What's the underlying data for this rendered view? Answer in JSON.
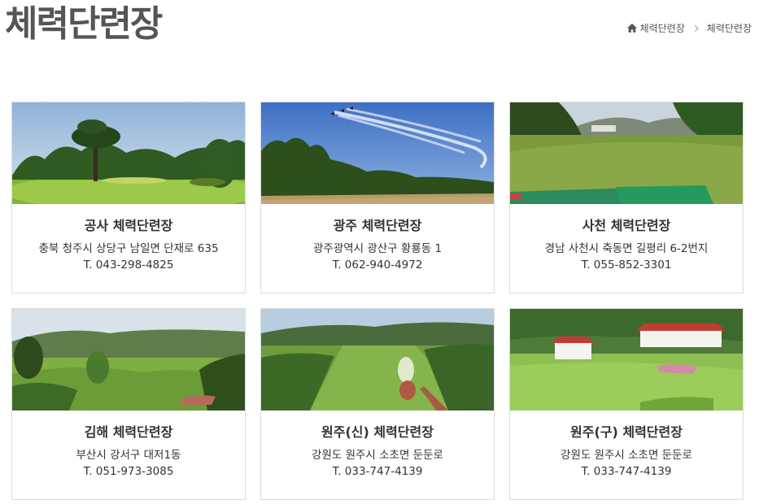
{
  "page": {
    "title": "체력단련장"
  },
  "breadcrumb": {
    "home_icon": "home-icon",
    "separator_icon": "chevron-right-icon",
    "items": [
      "체력단련장",
      "체력단련장"
    ]
  },
  "cards": [
    {
      "name": "공사 체력단련장",
      "address": "충북 청주시 상당구 남일면 단재로 635",
      "phone": "T. 043-298-4825"
    },
    {
      "name": "광주 체력단련장",
      "address": "광주광역시 광산구 황룡동 1",
      "phone": "T. 062-940-4972"
    },
    {
      "name": "사천 체력단련장",
      "address": "경남 사천시 축동면 길평리 6-2번지",
      "phone": "T. 055-852-3301"
    },
    {
      "name": "김해 체력단련장",
      "address": "부산시 강서구 대저1동",
      "phone": "T. 051-973-3085"
    },
    {
      "name": "원주(신) 체력단련장",
      "address": "강원도 원주시 소초면 둔둔로",
      "phone": "T. 033-747-4139"
    },
    {
      "name": "원주(구) 체력단련장",
      "address": "강원도 원주시 소초면 둔둔로",
      "phone": "T. 033-747-4139"
    }
  ]
}
